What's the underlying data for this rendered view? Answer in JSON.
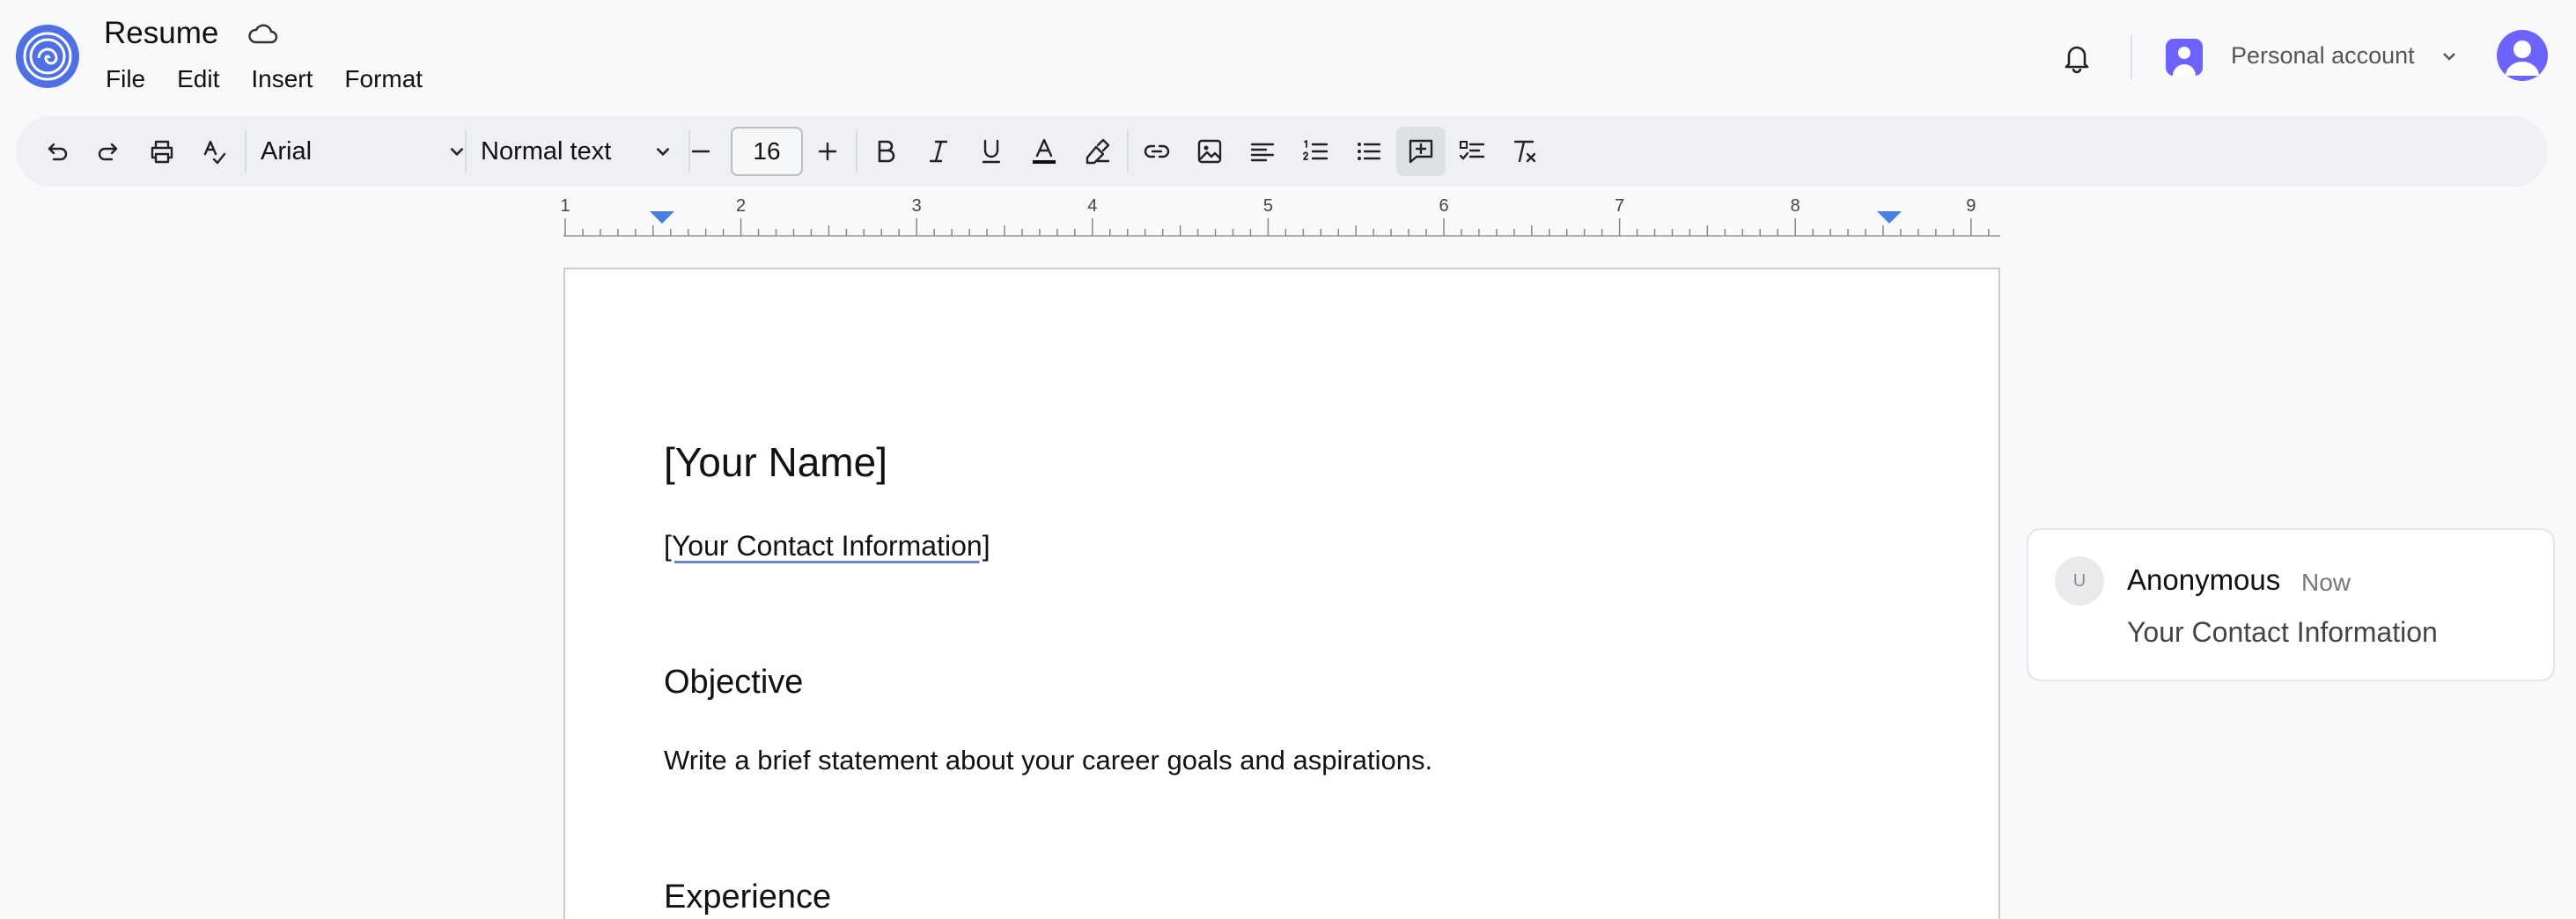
{
  "app": {
    "doc_title": "Resume",
    "menu": [
      "File",
      "Edit",
      "Insert",
      "Format"
    ]
  },
  "header": {
    "account_label": "Personal account"
  },
  "toolbar": {
    "font": "Arial",
    "style": "Normal text",
    "font_size": "16"
  },
  "ruler": {
    "marks": [
      "1",
      "2",
      "3",
      "4",
      "5",
      "6",
      "7",
      "8",
      "9"
    ]
  },
  "document": {
    "name": "[Your Name]",
    "contact": "[Your Contact Information]",
    "objective_heading": "Objective",
    "objective_body": "Write a brief statement about your career goals and aspirations.",
    "experience_heading": "Experience"
  },
  "comment": {
    "avatar_initial": "U",
    "author": "Anonymous",
    "time": "Now",
    "text": "Your Contact Information"
  },
  "colors": {
    "accent": "#4f6fe6",
    "avatar": "#6c63ff",
    "ruler_marker": "#4a7fe0"
  },
  "icons": [
    "logo-icon",
    "cloud-icon",
    "bell-icon",
    "chevron-down-icon",
    "undo-icon",
    "redo-icon",
    "print-icon",
    "spellcheck-icon",
    "minus-icon",
    "plus-icon",
    "bold-icon",
    "italic-icon",
    "underline-icon",
    "text-color-icon",
    "highlight-icon",
    "link-icon",
    "image-icon",
    "align-left-icon",
    "numbered-list-icon",
    "bulleted-list-icon",
    "add-comment-icon",
    "checklist-icon",
    "clear-format-icon"
  ]
}
